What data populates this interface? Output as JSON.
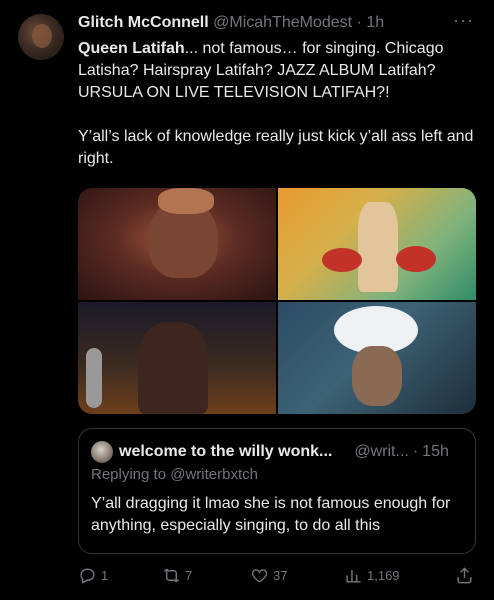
{
  "author": {
    "name": "Glitch McConnell",
    "handle": "@MicahTheModest",
    "separator": "·",
    "time": "1h"
  },
  "more_label": "···",
  "tweet": {
    "bold_name": "Queen Latifah",
    "line1_rest": "... not famous… for singing. Chicago Latisha? Hairspray Latifah? JAZZ ALBUM Latifah? URSULA ON LIVE TELEVISION LATIFAH?!",
    "paragraph2": "Y’all’s lack of knowledge really just kick y’all ass left and right."
  },
  "quote": {
    "name": "welcome to the willy wonk...",
    "handle": "@writ...",
    "separator": "·",
    "time": "15h",
    "replying_prefix": "Replying to ",
    "replying_handle": "@writerbxtch",
    "text": "Y’all dragging it lmao she is not famous enough for anything, especially singing, to do all this"
  },
  "actions": {
    "replies": "1",
    "retweets": "7",
    "likes": "37",
    "views": "1,169"
  },
  "icons": [
    "reply-icon",
    "retweet-icon",
    "like-icon",
    "views-icon",
    "share-icon",
    "more-icon"
  ]
}
